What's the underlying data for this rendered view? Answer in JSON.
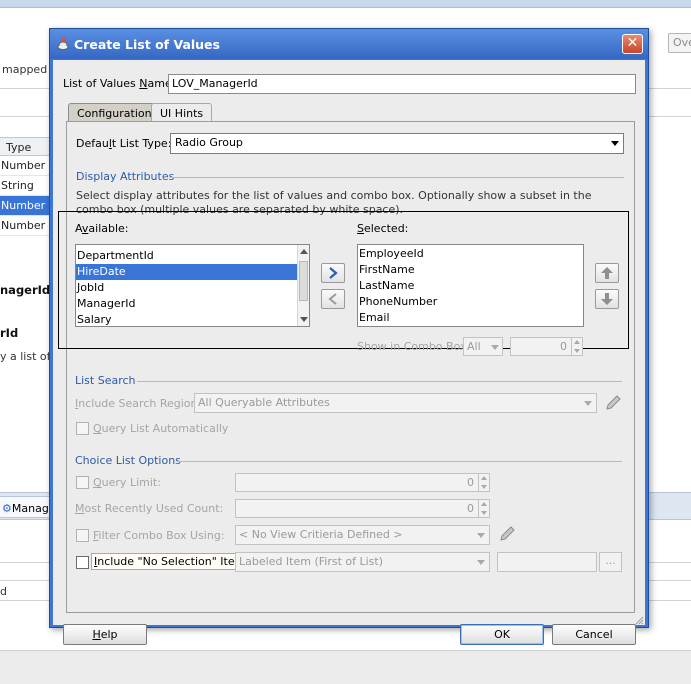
{
  "background": {
    "overflow_button": "Ove",
    "mapped_text": "mapped t",
    "table_header": "Type",
    "table_rows": [
      {
        "text": "Number",
        "selected": false
      },
      {
        "text": "String",
        "selected": false
      },
      {
        "text": "Number",
        "selected": true
      },
      {
        "text": "Number",
        "selected": false
      }
    ],
    "bold_label_1": "nagerId",
    "bold_label_2": "rId",
    "list_text": "y a list of v",
    "tab_label": "Manage",
    "lower_cell": "d"
  },
  "dialog": {
    "title": "Create List of Values",
    "close_symbol": "✕",
    "lov_name_label_pre": "List of Values ",
    "lov_name_label_u": "N",
    "lov_name_label_post": "ame:",
    "lov_name_value": "LOV_ManagerId",
    "tabs": {
      "configuration": "Configuration",
      "ui_hints": "UI Hints"
    },
    "default_list_type_label_pre": "Defau",
    "default_list_type_label_u": "l",
    "default_list_type_label_post": "t List Type:",
    "default_list_type_value": "Radio Group",
    "display_attributes": {
      "title": "Display Attributes",
      "description": "Select display attributes for the list of values and combo box. Optionally show a subset in the combo box (multiple values are separated by white space).",
      "available_label_pre": "A",
      "available_label_u": "v",
      "available_label_post": "ailable:",
      "available": [
        {
          "text": "DepartmentId",
          "selected": false
        },
        {
          "text": "HireDate",
          "selected": true
        },
        {
          "text": "JobId",
          "selected": false
        },
        {
          "text": "ManagerId",
          "selected": false
        },
        {
          "text": "Salary",
          "selected": false
        }
      ],
      "selected_label_u": "S",
      "selected_label_post": "elected:",
      "selected": [
        "EmployeeId",
        "FirstName",
        "LastName",
        "PhoneNumber",
        "Email"
      ],
      "show_in_combo_label": "Show in Combo Box:",
      "show_in_combo_value": "All",
      "show_in_combo_count": "0"
    },
    "list_search": {
      "title": "List Search",
      "include_region_label_pre": "",
      "include_region_label_u": "I",
      "include_region_label_post": "nclude Search Region:",
      "include_region_value": "All Queryable Attributes",
      "query_auto_label_u": "Q",
      "query_auto_label_post": "uery List Automatically"
    },
    "choice_list_options": {
      "title": "Choice List Options",
      "query_limit_label_u": "Q",
      "query_limit_label_post": "uery Limit:",
      "query_limit_value": "0",
      "mru_label_u": "M",
      "mru_label_post": "ost Recently Used Count:",
      "mru_value": "0",
      "filter_label_u": "F",
      "filter_label_post": "ilter Combo Box Using:",
      "filter_value": "< No View Critieria Defined >",
      "no_selection_label_u": "I",
      "no_selection_label_post": "nclude \"No Selection\" Item:",
      "no_selection_value": "Labeled Item (First of List)",
      "ellipsis": "..."
    },
    "buttons": {
      "help_u": "H",
      "help_post": "elp",
      "ok": "OK",
      "cancel": "Cancel"
    }
  },
  "colors": {
    "title_bar": "#3f76d4",
    "selection": "#3875d7",
    "section_title": "#2b5aa8"
  }
}
